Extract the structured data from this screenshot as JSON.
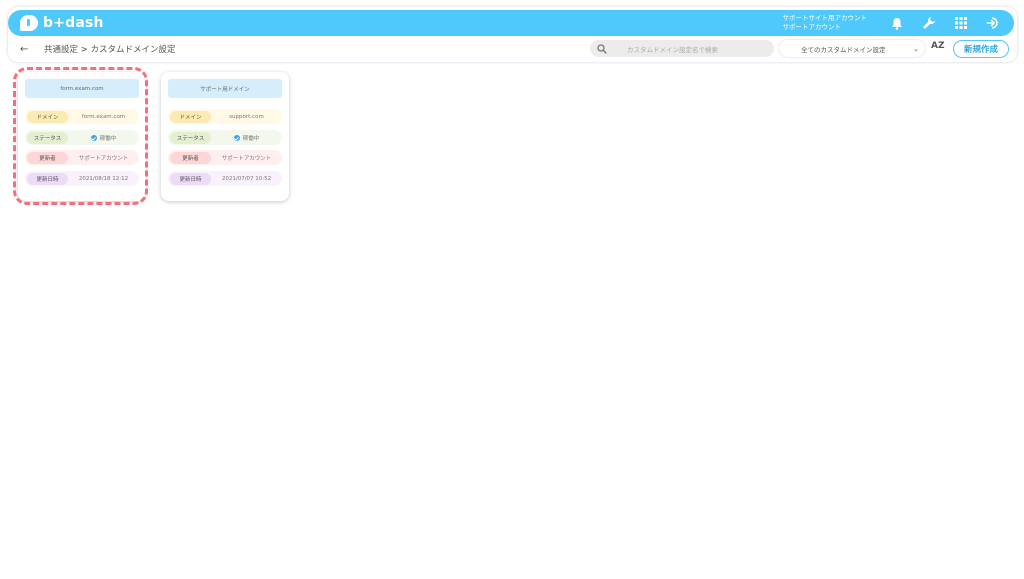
{
  "app": {
    "logo_text": "b+dash"
  },
  "header": {
    "account_line1": "サポートサイト用アカウント",
    "account_line2": "サポートアカウント",
    "icons": [
      "bell-icon",
      "wrench-icon",
      "grid-icon",
      "logout-icon"
    ]
  },
  "subbar": {
    "back_icon": "←",
    "breadcrumb": "共通設定 > カスタムドメイン設定",
    "search_placeholder": "カスタムドメイン設定名で検索",
    "filter_selected": "全てのカスタムドメイン設定",
    "sort_label": "AZ",
    "new_button": "新規作成"
  },
  "labels": {
    "domain": "ドメイン",
    "status": "ステータス",
    "updater": "更新者",
    "updated_at": "更新日時"
  },
  "cards": [
    {
      "title": "form.exam.com",
      "domain": "form.exam.com",
      "status": "稼働中",
      "updater": "サポートアカウント",
      "updated_at": "2021/08/18 12:12"
    },
    {
      "title": "サポート用ドメイン",
      "domain": "support.com",
      "status": "稼働中",
      "updater": "サポートアカウント",
      "updated_at": "2021/07/07 10:52"
    }
  ],
  "colors": {
    "brand": "#4fc9fb",
    "highlight": "#f2707e"
  }
}
